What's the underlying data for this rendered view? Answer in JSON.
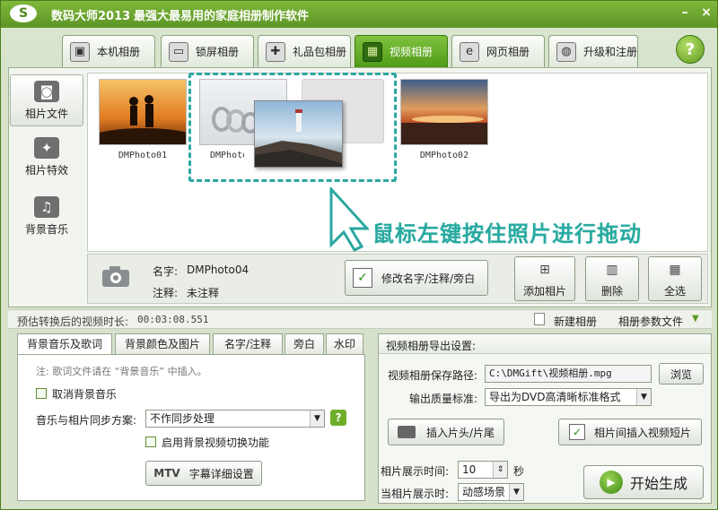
{
  "app": {
    "logo": "S",
    "title": "数码大师2013",
    "subtitle": "最强大最易用的家庭相册制作软件"
  },
  "window_controls": {
    "minimize": "–",
    "close": "×"
  },
  "tabs": [
    {
      "label": "本机相册",
      "icon": "person-icon",
      "glyph": "▣"
    },
    {
      "label": "锁屏相册",
      "icon": "monitor-icon",
      "glyph": "▭"
    },
    {
      "label": "礼品包相册",
      "icon": "gift-icon",
      "glyph": "✚"
    },
    {
      "label": "视频相册",
      "icon": "film-icon",
      "glyph": "▦",
      "active": true
    },
    {
      "label": "网页相册",
      "icon": "ie-icon",
      "glyph": "e"
    },
    {
      "label": "升级和注册",
      "icon": "globe-icon",
      "glyph": "◍"
    }
  ],
  "help": "?",
  "sidebar": [
    {
      "label": "相片文件",
      "icon": "camera-icon",
      "glyph": "◙",
      "active": true
    },
    {
      "label": "相片特效",
      "icon": "effects-icon",
      "glyph": "✦"
    },
    {
      "label": "背景音乐",
      "icon": "music-icon",
      "glyph": "♫"
    }
  ],
  "photos": [
    {
      "caption": "DMPhoto01"
    },
    {
      "caption": "DMPhoto04"
    },
    {
      "caption": "DMPhoto02"
    }
  ],
  "drag_tip": "鼠标左键按住照片进行拖动",
  "info": {
    "name_label": "名字:",
    "name_value": "DMPhoto04",
    "note_label": "注释:",
    "note_value": "未注释",
    "edit_button": "修改名字/注释/旁白",
    "add_button": "添加相片",
    "delete_button": "删除",
    "select_all_button": "全选"
  },
  "status": {
    "duration_label": "预估转换后的视频时长:",
    "duration_value": "00:03:08.551",
    "new_album": "新建相册",
    "param_file": "相册参数文件"
  },
  "subtabs": [
    "背景音乐及歌词",
    "背景颜色及图片",
    "名字/注释",
    "旁白",
    "水印"
  ],
  "music": {
    "note": "注: 歌词文件请在 “背景音乐” 中插入。",
    "cancel_music": "取消背景音乐",
    "sync_label": "音乐与相片同步方案:",
    "sync_value": "不作同步处理",
    "enable_video_switch": "启用背景视频切换功能",
    "mtv_button": "字幕详细设置",
    "mtv_badge": "MTV"
  },
  "export": {
    "title": "视频相册导出设置:",
    "path_label": "视频相册保存路径:",
    "path_value": "C:\\DMGift\\视频相册.mpg",
    "browse": "浏览",
    "quality_label": "输出质量标准:",
    "quality_value": "导出为DVD高清晰标准格式",
    "insert_head": "插入片头/片尾",
    "insert_between": "相片间插入视频短片",
    "duration_label": "相片展示时间:",
    "duration_value": "10",
    "duration_unit": "秒",
    "when_label": "当相片展示时:",
    "when_value": "动感场景",
    "start_button": "开始生成"
  }
}
